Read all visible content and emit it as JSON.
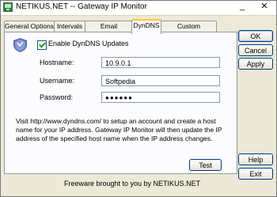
{
  "window": {
    "title": "NETIKUS.NET -- Gateway IP Monitor",
    "minimize_glyph": "_",
    "close_glyph": "✕"
  },
  "tabs": [
    {
      "label": "General Options"
    },
    {
      "label": "Intervals"
    },
    {
      "label": "Email Notification"
    },
    {
      "label": "DynDNS"
    },
    {
      "label": "Custom Notifications"
    }
  ],
  "dyndns": {
    "enable_label": "Enable DynDNS Updates",
    "enable_checked": true,
    "hostname_label": "Hostname:",
    "hostname_value": "10.9.0.1",
    "username_label": "Username:",
    "username_value": "Softpedia",
    "password_label": "Password:",
    "password_value": "●●●●●●",
    "help_text": "Visit http://www.dyndns.com/ to setup an account and create a host name for your IP address. Gateway IP Monitor will then update the IP address of the specified host name when the IP address changes.",
    "test_label": "Test"
  },
  "buttons": {
    "ok": "OK",
    "cancel": "Cancel",
    "apply": "Apply",
    "help": "Help",
    "exit": "Exit"
  },
  "footer": "Freeware brought to you by NETIKUS.NET",
  "icons": {
    "app": "app-network-icon",
    "dyndns": "dyndns-shield-icon"
  }
}
